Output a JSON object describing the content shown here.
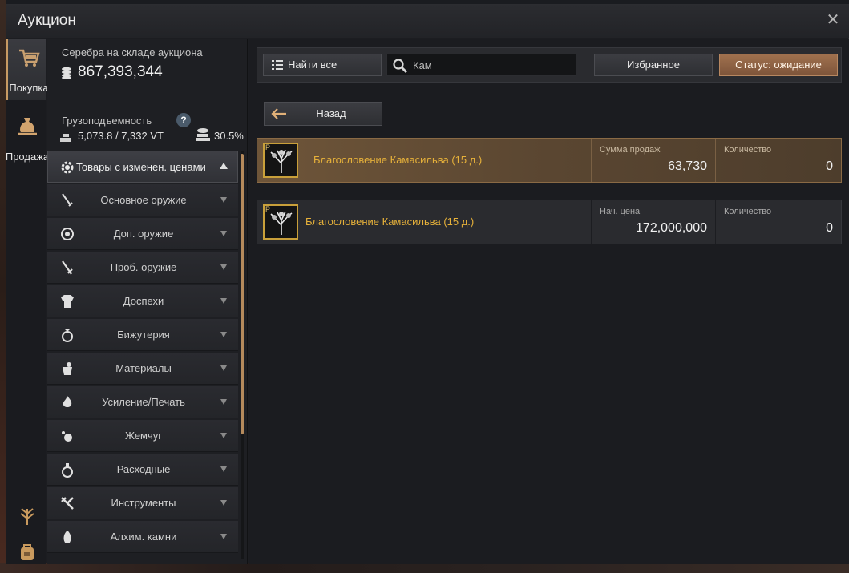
{
  "window": {
    "title": "Аукцион",
    "close": "✕"
  },
  "rail": {
    "tabs": [
      {
        "label": "Покупка",
        "icon": "cart-icon"
      },
      {
        "label": "Продажа",
        "icon": "money-bag-icon"
      }
    ]
  },
  "left": {
    "silver_label": "Серебра на складе аукциона",
    "silver_value": "867,393,344",
    "weight_label": "Грузоподъемность",
    "help": "?",
    "weight_value": "5,073.8 / 7,332 VT",
    "weight_pct": "30.5%",
    "header": "Товары с изменен. ценами",
    "categories": [
      {
        "label": "Основное оружие",
        "icon": "sword-icon"
      },
      {
        "label": "Доп. оружие",
        "icon": "shield-icon"
      },
      {
        "label": "Проб. оружие",
        "icon": "blade-icon"
      },
      {
        "label": "Доспехи",
        "icon": "armor-icon"
      },
      {
        "label": "Бижутерия",
        "icon": "ring-icon"
      },
      {
        "label": "Материалы",
        "icon": "materials-icon"
      },
      {
        "label": "Усиление/Печать",
        "icon": "flame-icon"
      },
      {
        "label": "Жемчуг",
        "icon": "pearl-icon"
      },
      {
        "label": "Расходные",
        "icon": "potion-icon"
      },
      {
        "label": "Инструменты",
        "icon": "tools-icon"
      },
      {
        "label": "Алхим. камни",
        "icon": "stone-icon"
      }
    ]
  },
  "toolbar": {
    "find_all": "Найти все",
    "search_value": "Кам",
    "favorites": "Избранное",
    "status": "Статус: ожидание",
    "back": "Назад"
  },
  "rows": [
    {
      "name": "Благословение Камасильва (15 д.)",
      "col1_caption": "Сумма продаж",
      "col1_value": "63,730",
      "col2_caption": "Количество",
      "col2_value": "0"
    },
    {
      "name": "Благословение Камасильва (15 д.)",
      "col1_caption": "Нач. цена",
      "col1_value": "172,000,000",
      "col2_caption": "Количество",
      "col2_value": "0"
    }
  ],
  "colors": {
    "accent": "#b58a5c",
    "item_name": "#e6b13a",
    "highlight_row": "#5a4631"
  }
}
